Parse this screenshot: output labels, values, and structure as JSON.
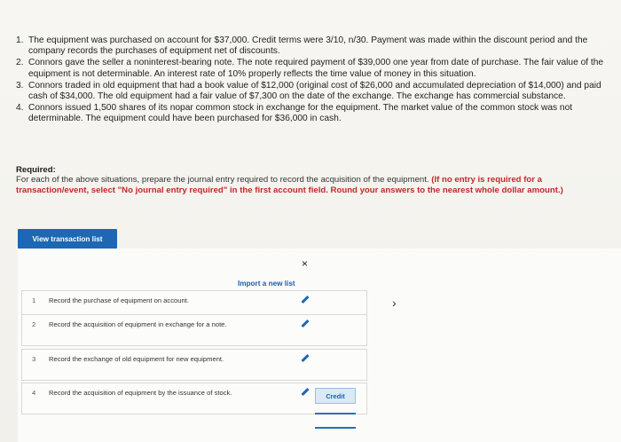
{
  "situations": [
    {
      "num": "1.",
      "text": "The equipment was purchased on account for $37,000. Credit terms were 3/10, n/30. Payment was made within the discount period and the company records the purchases of equipment net of discounts."
    },
    {
      "num": "2.",
      "text": "Connors gave the seller a noninterest-bearing note. The note required payment of $39,000 one year from date of purchase. The fair value of the equipment is not determinable. An interest rate of 10% properly reflects the time value of money in this situation."
    },
    {
      "num": "3.",
      "text": "Connors traded in old equipment that had a book value of $12,000 (original cost of $26,000 and accumulated depreciation of $14,000) and paid cash of $34,000. The old equipment had a fair value of $7,300 on the date of the exchange. The exchange has commercial substance."
    },
    {
      "num": "4.",
      "text": "Connors issued 1,500 shares of its nopar common stock in exchange for the equipment. The market value of the common stock was not determinable. The equipment could have been purchased for $36,000 in cash."
    }
  ],
  "required": {
    "heading": "Required:",
    "instruction": "For each of the above situations, prepare the journal entry required to record the acquisition of the equipment.",
    "note": "(If no entry is required for a transaction/event, select \"No journal entry required\" in the first account field. Round your answers to the nearest whole dollar amount.)"
  },
  "view_button": "View transaction list",
  "close_glyph": "×",
  "import_link": "Import a new list",
  "next_glyph": "›",
  "transactions": [
    {
      "num": "1",
      "text": "Record the purchase of equipment on account."
    },
    {
      "num": "2",
      "text": "Record the acquisition of equipment in exchange for a note."
    },
    {
      "num": "3",
      "text": "Record the exchange of old equipment for new equipment."
    },
    {
      "num": "4",
      "text": "Record the acquisition of equipment by the issuance of stock."
    }
  ],
  "credit_label": "Credit"
}
